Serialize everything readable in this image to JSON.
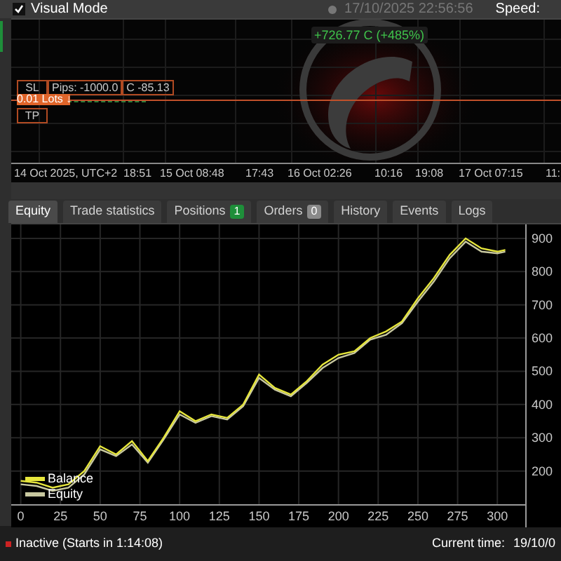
{
  "top_bar": {
    "visual_mode": {
      "label": "Visual Mode",
      "checked": true
    },
    "datetime": "17/10/2025 22:56:56",
    "speed_label": "Speed:"
  },
  "price_chart": {
    "profit_badge": "+726.77 C (+485%)",
    "sl_label": "SL",
    "pips": "Pips: -1000.0",
    "money": "C -85.13",
    "lots": "0.01 Lots ↓",
    "tp_label": "TP",
    "time_labels": [
      "14 Oct 2025, UTC+2",
      "18:51",
      "15 Oct 08:48",
      "17:43",
      "16 Oct 02:26",
      "10:16",
      "19:08",
      "17 Oct 07:15",
      "11:"
    ]
  },
  "tabs": [
    {
      "label": "Equity",
      "selected": true
    },
    {
      "label": "Trade statistics",
      "selected": false
    },
    {
      "label": "Positions",
      "selected": false,
      "badge": "1",
      "color": "#1e8f3a"
    },
    {
      "label": "Orders",
      "selected": false,
      "badge": "0",
      "color": "#8a8a8a"
    },
    {
      "label": "History",
      "selected": false
    },
    {
      "label": "Events",
      "selected": false
    },
    {
      "label": "Logs",
      "selected": false
    }
  ],
  "equity_chart": {
    "chart_data": {
      "type": "line",
      "x": [
        0,
        10,
        20,
        30,
        40,
        50,
        60,
        70,
        80,
        90,
        100,
        110,
        120,
        130,
        140,
        150,
        160,
        170,
        180,
        190,
        200,
        210,
        220,
        230,
        240,
        250,
        260,
        270,
        280,
        290,
        300,
        305
      ],
      "series": [
        {
          "name": "Balance",
          "color": "#e6e63c",
          "values": [
            170,
            165,
            150,
            160,
            200,
            275,
            250,
            290,
            230,
            300,
            380,
            350,
            370,
            360,
            400,
            490,
            450,
            430,
            470,
            520,
            550,
            560,
            600,
            620,
            650,
            720,
            780,
            850,
            900,
            870,
            860,
            865
          ]
        },
        {
          "name": "Equity",
          "color": "#c8c8a0",
          "values": [
            160,
            155,
            140,
            150,
            190,
            265,
            245,
            280,
            225,
            295,
            370,
            345,
            365,
            355,
            395,
            480,
            445,
            425,
            465,
            510,
            540,
            555,
            595,
            610,
            645,
            710,
            770,
            840,
            890,
            860,
            855,
            860
          ]
        }
      ],
      "xticks": [
        0,
        25,
        50,
        75,
        100,
        125,
        150,
        175,
        200,
        225,
        250,
        275,
        300
      ],
      "yticks": [
        200,
        300,
        400,
        500,
        600,
        700,
        800,
        900
      ],
      "xlim": [
        -6,
        318
      ],
      "ylim": [
        98,
        942
      ],
      "grid": true,
      "legend": "bottom-left"
    }
  },
  "status_bar": {
    "state": "Inactive (Starts in 1:14:08)",
    "current_time_label": "Current time:",
    "current_time": "19/10/0"
  }
}
